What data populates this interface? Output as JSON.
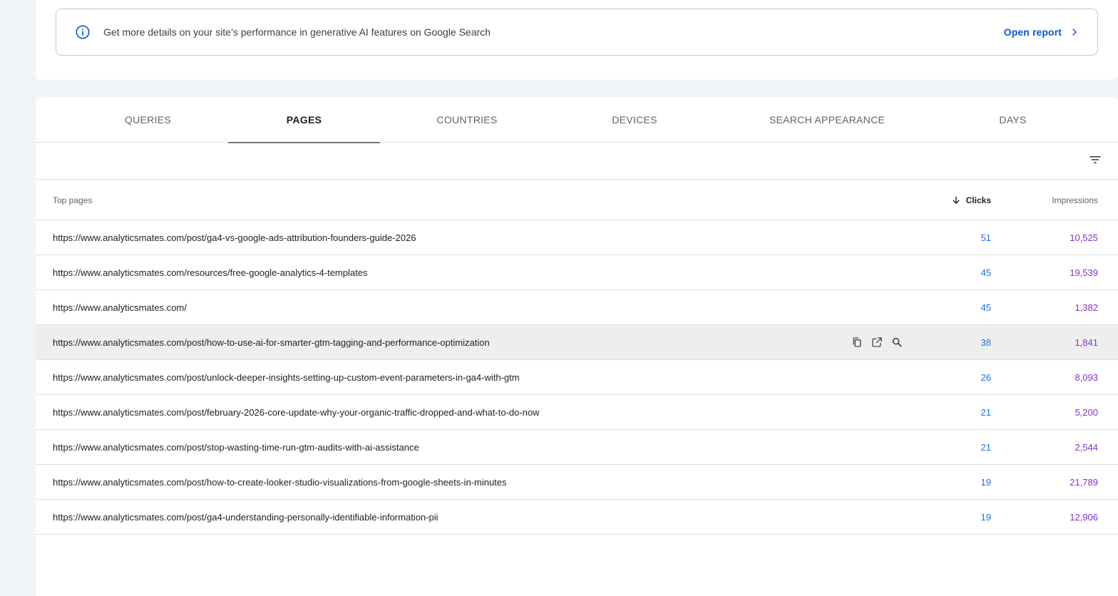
{
  "banner": {
    "text": "Get more details on your site’s performance in generative AI features on Google Search",
    "link_label": "Open report",
    "icon": "info-icon",
    "link_icon": "chevron-right-icon"
  },
  "tabs": [
    {
      "label": "QUERIES",
      "active": false
    },
    {
      "label": "PAGES",
      "active": true
    },
    {
      "label": "COUNTRIES",
      "active": false
    },
    {
      "label": "DEVICES",
      "active": false
    },
    {
      "label": "SEARCH APPEARANCE",
      "active": false
    },
    {
      "label": "DAYS",
      "active": false
    }
  ],
  "toolbar": {
    "filter_icon": "filter-list-icon"
  },
  "table": {
    "columns": {
      "pages": "Top pages",
      "clicks": "Clicks",
      "impressions": "Impressions",
      "sort_icon": "arrow-downward-icon"
    },
    "rows": [
      {
        "url": "https://www.analyticsmates.com/post/ga4-vs-google-ads-attribution-founders-guide-2026",
        "clicks": "51",
        "impressions": "10,525"
      },
      {
        "url": "https://www.analyticsmates.com/resources/free-google-analytics-4-templates",
        "clicks": "45",
        "impressions": "19,539"
      },
      {
        "url": "https://www.analyticsmates.com/",
        "clicks": "45",
        "impressions": "1,382"
      },
      {
        "url": "https://www.analyticsmates.com/post/how-to-use-ai-for-smarter-gtm-tagging-and-performance-optimization",
        "clicks": "38",
        "impressions": "1,841"
      },
      {
        "url": "https://www.analyticsmates.com/post/unlock-deeper-insights-setting-up-custom-event-parameters-in-ga4-with-gtm",
        "clicks": "26",
        "impressions": "8,093"
      },
      {
        "url": "https://www.analyticsmates.com/post/february-2026-core-update-why-your-organic-traffic-dropped-and-what-to-do-now",
        "clicks": "21",
        "impressions": "5,200"
      },
      {
        "url": "https://www.analyticsmates.com/post/stop-wasting-time-run-gtm-audits-with-ai-assistance",
        "clicks": "21",
        "impressions": "2,544"
      },
      {
        "url": "https://www.analyticsmates.com/post/how-to-create-looker-studio-visualizations-from-google-sheets-in-minutes",
        "clicks": "19",
        "impressions": "21,789"
      },
      {
        "url": "https://www.analyticsmates.com/post/ga4-understanding-personally-identifiable-information-pii",
        "clicks": "19",
        "impressions": "12,906"
      }
    ],
    "row_action_icons": [
      "copy-icon",
      "open-in-new-icon",
      "inspect-url-icon"
    ]
  },
  "colors": {
    "accent": "#0b57d0",
    "clicks": "#1a73e8",
    "impressions": "#8430ce",
    "hover_row": "#eeeeee",
    "background": "#f0f4f9"
  }
}
